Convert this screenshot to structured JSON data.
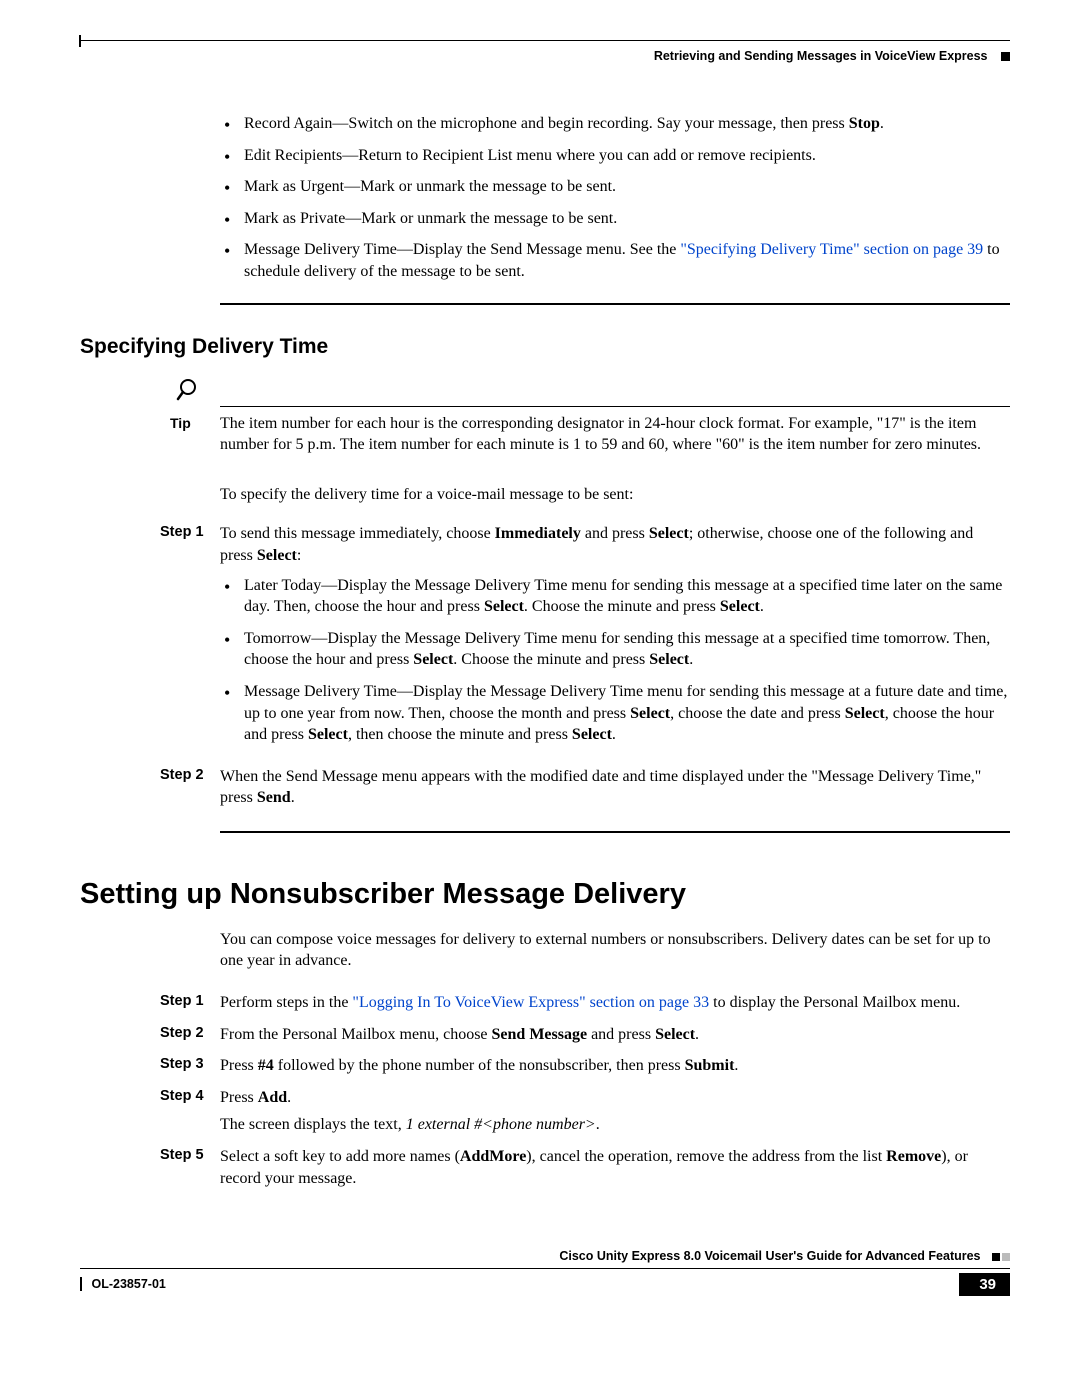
{
  "header": {
    "chapter": "Retrieving and Sending Messages in VoiceView Express"
  },
  "top_bullets": {
    "b1_pre": "Record Again—Switch on the microphone and begin recording. Say your message, then press ",
    "b1_bold": "Stop",
    "b1_post": ".",
    "b2": "Edit Recipients—Return to Recipient List menu where you can add or remove recipients.",
    "b3": "Mark as Urgent—Mark or unmark the message to be sent.",
    "b4": "Mark as Private—Mark or unmark the message to be sent.",
    "b5_pre": "Message Delivery Time—Display the Send Message menu. See the ",
    "b5_link": "\"Specifying Delivery Time\" section on page 39",
    "b5_post": " to schedule delivery of the message to be sent."
  },
  "specifying": {
    "heading": "Specifying Delivery Time",
    "tip_label": "Tip",
    "tip_text": "The item number for each hour is the corresponding designator in 24-hour clock format. For example, \"17\" is the item number for 5 p.m. The item number for each minute is 1 to 59 and 60, where \"60\" is the item number for zero minutes.",
    "intro": "To specify the delivery time for a voice-mail message to be sent:",
    "step1_label": "Step 1",
    "step1_a": "To send this message immediately, choose ",
    "step1_b": "Immediately",
    "step1_c": " and press ",
    "step1_d": "Select",
    "step1_e": "; otherwise, choose one of the following and press ",
    "step1_f": "Select",
    "step1_g": ":",
    "s1b1_a": "Later Today—Display the Message Delivery Time menu for sending this message at a specified time later on the same day. Then, choose the hour and press ",
    "s1b1_b": "Select",
    "s1b1_c": ". Choose the minute and press ",
    "s1b1_d": "Select",
    "s1b1_e": ".",
    "s1b2_a": "Tomorrow—Display the Message Delivery Time menu for sending this message at a specified time tomorrow. Then, choose the hour and press ",
    "s1b2_b": "Select",
    "s1b2_c": ". Choose the minute and press ",
    "s1b2_d": "Select",
    "s1b2_e": ".",
    "s1b3_a": "Message Delivery Time—Display the Message Delivery Time menu for sending this message at a future date and time, up to one year from now. Then, choose the month and press ",
    "s1b3_b": "Select",
    "s1b3_c": ", choose the date and press ",
    "s1b3_d": "Select",
    "s1b3_e": ", choose the hour and press ",
    "s1b3_f": "Select",
    "s1b3_g": ", then choose the minute and press ",
    "s1b3_h": "Select",
    "s1b3_i": ".",
    "step2_label": "Step 2",
    "step2_a": "When the Send Message menu appears with the modified date and time displayed under the \"Message Delivery Time,\" press ",
    "step2_b": "Send",
    "step2_c": "."
  },
  "nonsub": {
    "heading": "Setting up Nonsubscriber Message Delivery",
    "intro": "You can compose voice messages for delivery to external numbers or nonsubscribers. Delivery dates can be set for up to one year in advance.",
    "step1_label": "Step 1",
    "step1_a": "Perform steps in the ",
    "step1_link": "\"Logging In To VoiceView Express\" section on page 33",
    "step1_b": " to display the Personal Mailbox menu.",
    "step2_label": "Step 2",
    "step2_a": "From the Personal Mailbox menu, choose ",
    "step2_b": "Send Message",
    "step2_c": " and press ",
    "step2_d": "Select",
    "step2_e": ".",
    "step3_label": "Step 3",
    "step3_a": "Press ",
    "step3_b": "#4",
    "step3_c": " followed by the phone number of the nonsubscriber, then press ",
    "step3_d": "Submit",
    "step3_e": ".",
    "step4_label": "Step 4",
    "step4_a": "Press ",
    "step4_b": "Add",
    "step4_c": ".",
    "step4_screen_a": "The screen displays the text, ",
    "step4_screen_b": "1 external #<phone number>",
    "step4_screen_c": ".",
    "step5_label": "Step 5",
    "step5_a": "Select a soft key to add more names (",
    "step5_b": "AddMore",
    "step5_c": "), cancel the operation, remove the address from the list ",
    "step5_d": "Remove",
    "step5_e": "), or record your message."
  },
  "footer": {
    "book": "Cisco Unity Express 8.0 Voicemail User's Guide for Advanced Features",
    "docid": "OL-23857-01",
    "page": "39"
  }
}
